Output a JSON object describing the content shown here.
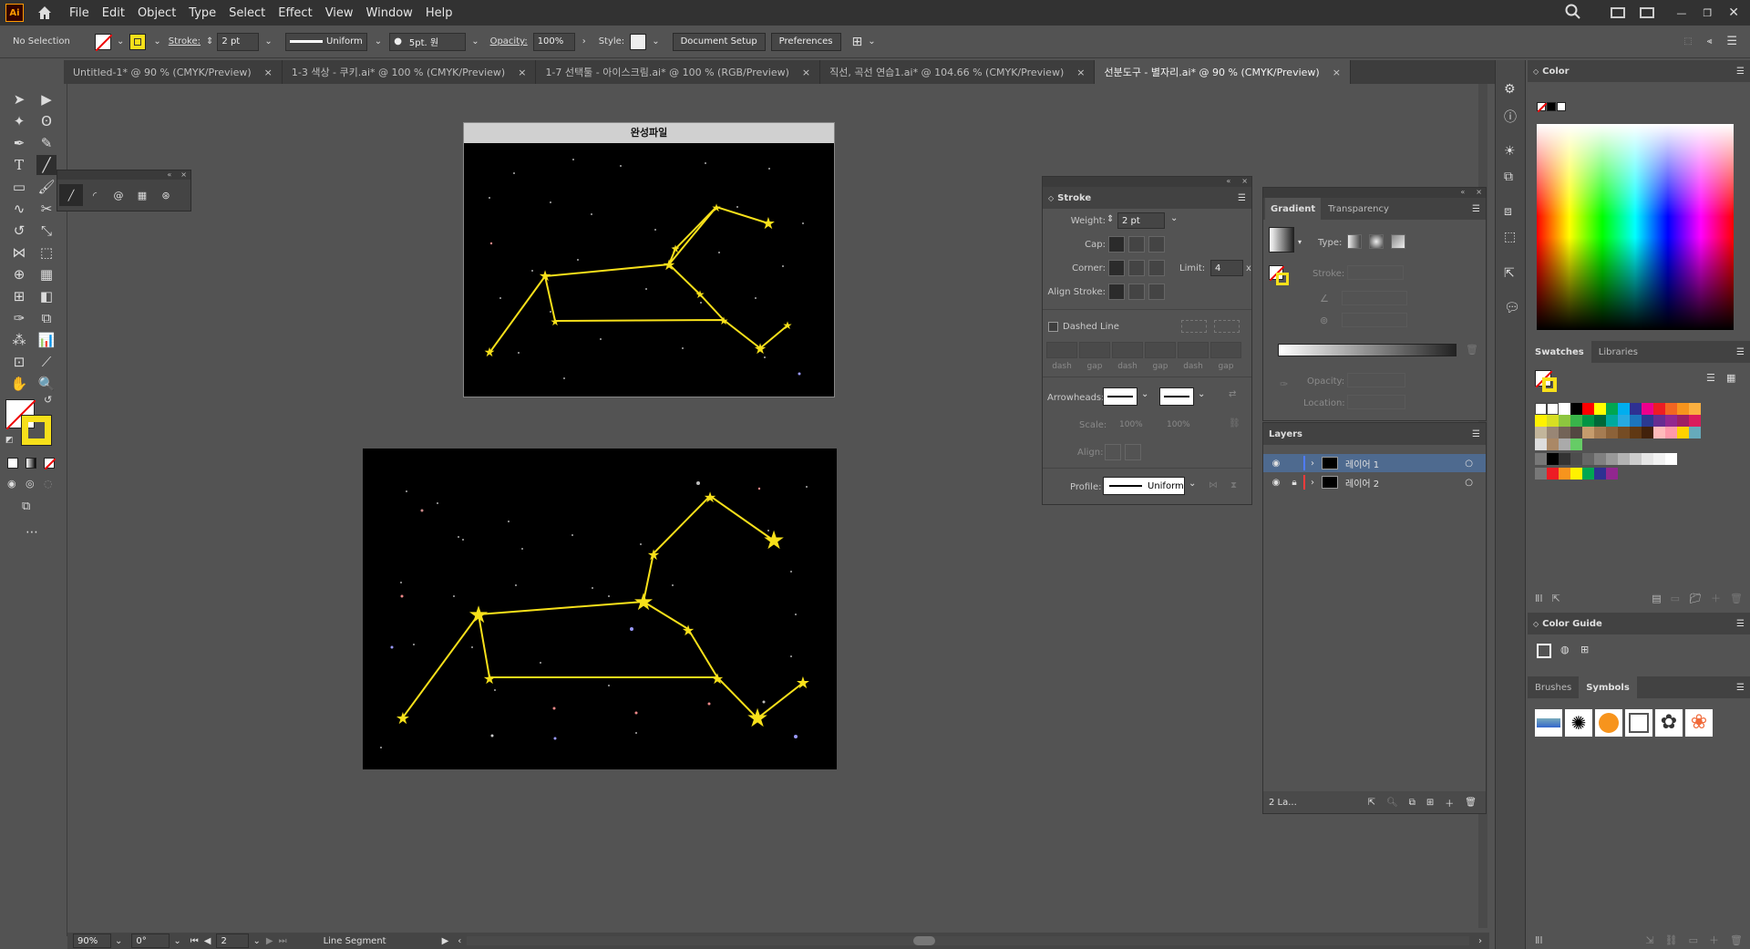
{
  "menubar": {
    "logo": "Ai",
    "items": [
      "File",
      "Edit",
      "Object",
      "Type",
      "Select",
      "Effect",
      "View",
      "Window",
      "Help"
    ]
  },
  "controlbar": {
    "selection": "No Selection",
    "stroke_label": "Stroke:",
    "stroke_value": "2 pt",
    "profile_value": "Uniform",
    "brush_value": "5pt. 원",
    "opacity_label": "Opacity:",
    "opacity_value": "100%",
    "style_label": "Style:",
    "document_setup": "Document Setup",
    "preferences": "Preferences"
  },
  "tabs": [
    {
      "label": "Untitled-1* @ 90 % (CMYK/Preview)",
      "active": false
    },
    {
      "label": "1-3 색상 - 쿠키.ai* @ 100 % (CMYK/Preview)",
      "active": false
    },
    {
      "label": "1-7 선택툴 - 아이스크림.ai* @ 100 % (RGB/Preview)",
      "active": false
    },
    {
      "label": "직선, 곡선 연습1.ai* @ 104.66 % (CMYK/Preview)",
      "active": false
    },
    {
      "label": "선분도구 - 별자리.ai* @ 90 % (CMYK/Preview)",
      "active": true
    }
  ],
  "artboard": {
    "reference_title": "완성파일"
  },
  "stroke_panel": {
    "title": "Stroke",
    "weight_label": "Weight:",
    "weight_value": "2 pt",
    "cap_label": "Cap:",
    "corner_label": "Corner:",
    "limit_label": "Limit:",
    "limit_value": "4",
    "limit_unit": "x",
    "align_label": "Align Stroke:",
    "dashed_label": "Dashed Line",
    "dash_labels": [
      "dash",
      "gap",
      "dash",
      "gap",
      "dash",
      "gap"
    ],
    "arrowheads_label": "Arrowheads:",
    "scale_label": "Scale:",
    "scale_values": [
      "100%",
      "100%"
    ],
    "align2_label": "Align:",
    "profile_label": "Profile:",
    "profile_value": "Uniform"
  },
  "gradient_panel": {
    "tab_gradient": "Gradient",
    "tab_transparency": "Transparency",
    "type_label": "Type:",
    "stroke_label": "Stroke:",
    "opacity_label": "Opacity:",
    "location_label": "Location:"
  },
  "layers_panel": {
    "title": "Layers",
    "layers": [
      {
        "name": "레이어 1",
        "color": "#4f7bff",
        "selected": true
      },
      {
        "name": "레이어 2",
        "color": "#ff3b3b",
        "selected": false
      }
    ],
    "footer_count": "2 La..."
  },
  "right_panels": {
    "color_title": "Color",
    "swatches_tab": "Swatches",
    "libraries_tab": "Libraries",
    "color_guide_title": "Color Guide",
    "brushes_tab": "Brushes",
    "symbols_tab": "Symbols"
  },
  "statusbar": {
    "zoom": "90%",
    "rotation": "0°",
    "artboard_num": "2",
    "tool_name": "Line Segment"
  },
  "colors": {
    "constellation": "#f7e01a",
    "artboard_bg": "#000000",
    "ui_bg": "#535353"
  }
}
